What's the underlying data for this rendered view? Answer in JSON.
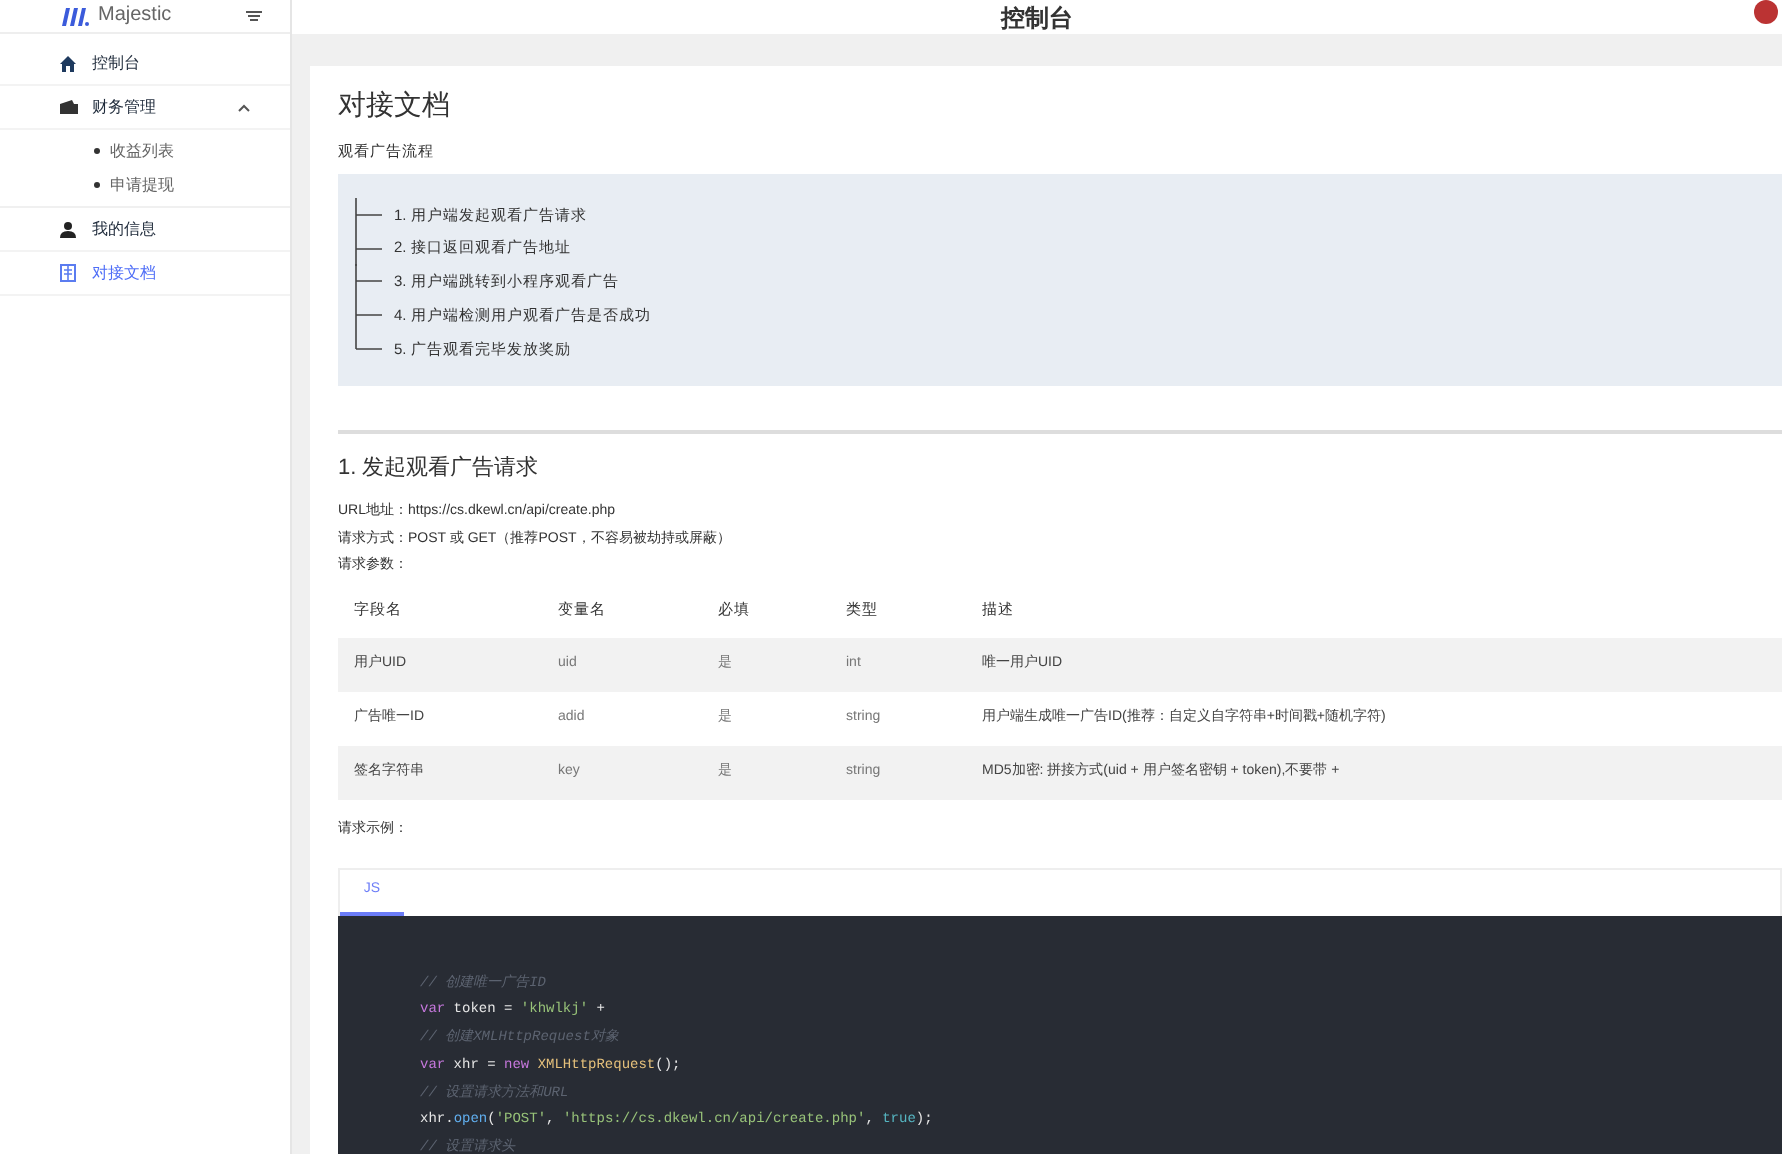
{
  "brand": {
    "name": "Majestic"
  },
  "header": {
    "title": "控制台"
  },
  "sidebar": {
    "items": [
      {
        "label": "控制台",
        "selected": false
      },
      {
        "label": "财务管理",
        "selected": false,
        "expanded": true,
        "children": [
          {
            "label": "收益列表"
          },
          {
            "label": "申请提现"
          }
        ]
      },
      {
        "label": "我的信息",
        "selected": false
      },
      {
        "label": "对接文档",
        "selected": true
      }
    ]
  },
  "doc": {
    "title": "对接文档",
    "flow_label": "观看广告流程",
    "flow": [
      "1. 用户端发起观看广告请求",
      "2. 接口返回观看广告地址",
      "3. 用户端跳转到小程序观看广告",
      "4. 用户端检测用户观看广告是否成功",
      "5. 广告观看完毕发放奖励"
    ],
    "section_title": "1. 发起观看广告请求",
    "info": [
      "URL地址：https://cs.dkewl.cn/api/create.php",
      "请求方式：POST 或 GET（推荐POST，不容易被劫持或屏蔽）",
      "请求参数："
    ],
    "table": {
      "columns": [
        "字段名",
        "变量名",
        "必填",
        "类型",
        "描述"
      ],
      "rows": [
        [
          "用户UID",
          "uid",
          "是",
          "int",
          "唯一用户UID"
        ],
        [
          "广告唯一ID",
          "adid",
          "是",
          "string",
          "用户端生成唯一广告ID(推荐：自定义自字符串+时间戳+随机字符)"
        ],
        [
          "签名字符串",
          "key",
          "是",
          "string",
          "MD5加密: 拼接方式(uid + 用户签名密钥 + token),不要带 +"
        ]
      ]
    },
    "example_label": "请求示例：",
    "tabs": [
      {
        "label": "JS",
        "selected": true
      }
    ],
    "code": [
      [
        {
          "kind": "comment",
          "text": "// 创建唯一广告ID"
        }
      ],
      [
        {
          "kind": "keyword",
          "text": "var"
        },
        {
          "kind": "plain",
          "text": " token = "
        },
        {
          "kind": "string",
          "text": "'khwlkj'"
        },
        {
          "kind": "plain",
          "text": " +"
        }
      ],
      [
        {
          "kind": "comment",
          "text": "// 创建XMLHttpRequest对象"
        }
      ],
      [
        {
          "kind": "keyword",
          "text": "var"
        },
        {
          "kind": "plain",
          "text": " xhr = "
        },
        {
          "kind": "keyword",
          "text": "new "
        },
        {
          "kind": "class",
          "text": "XMLHttpRequest"
        },
        {
          "kind": "plain",
          "text": "();"
        }
      ],
      [
        {
          "kind": "comment",
          "text": "// 设置请求方法和URL"
        }
      ],
      [
        {
          "kind": "plain",
          "text": "xhr."
        },
        {
          "kind": "function",
          "text": "open"
        },
        {
          "kind": "plain",
          "text": "("
        },
        {
          "kind": "string",
          "text": "'POST'"
        },
        {
          "kind": "plain",
          "text": ", "
        },
        {
          "kind": "string",
          "text": "'https://cs.dkewl.cn/api/create.php'"
        },
        {
          "kind": "plain",
          "text": ", "
        },
        {
          "kind": "boolean",
          "text": "true"
        },
        {
          "kind": "plain",
          "text": ");"
        }
      ],
      [
        {
          "kind": "comment",
          "text": "// 设置请求头"
        }
      ]
    ]
  }
}
